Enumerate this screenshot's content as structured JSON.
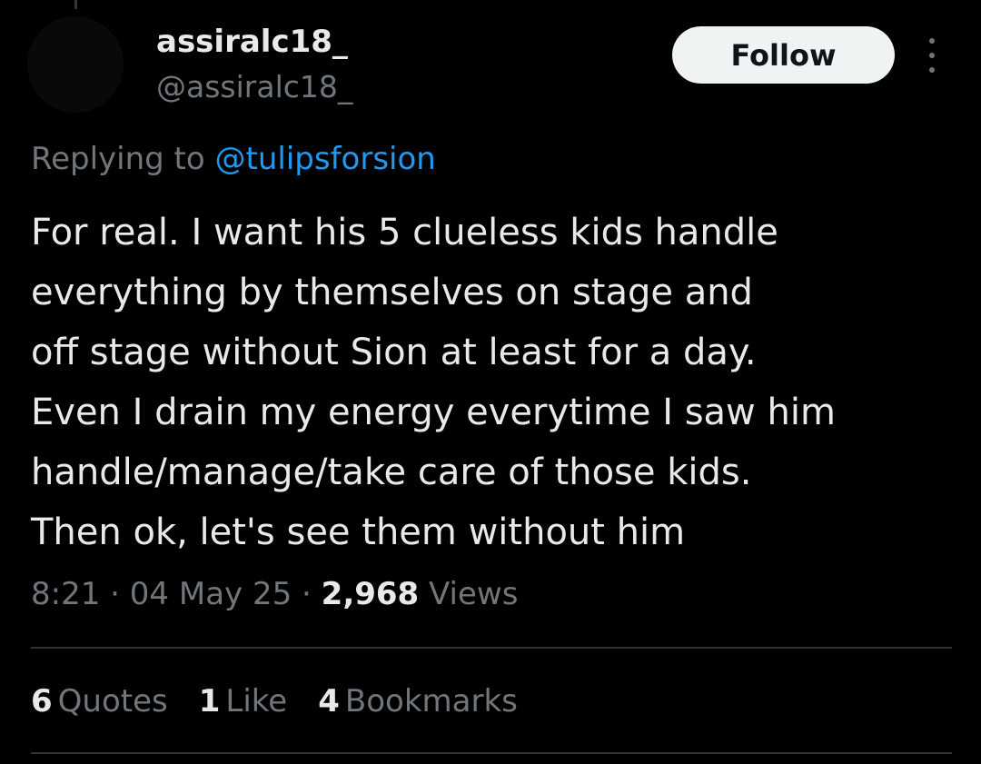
{
  "author": {
    "display_name": "assiralc18_",
    "handle": "@assiralc18_"
  },
  "follow_button": {
    "label": "Follow"
  },
  "reply_context": {
    "prefix": "Replying to ",
    "mention": "@tulipsforsion"
  },
  "tweet": {
    "lines": [
      "For real. I want his 5 clueless kids handle",
      "everything by themselves on stage and",
      "off stage without Sion at least for a day.",
      "Even I drain my energy everytime I saw him",
      "handle/manage/take care of those kids.",
      "Then ok, let's see them without him"
    ]
  },
  "meta": {
    "time": "8:21",
    "separator": " · ",
    "date": "04 May 25",
    "views_count": "2,968",
    "views_label": " Views"
  },
  "stats": {
    "quotes_count": "6",
    "quotes_label": "Quotes",
    "likes_count": "1",
    "likes_label": "Like",
    "bookmarks_count": "4",
    "bookmarks_label": "Bookmarks"
  },
  "icons": {
    "more": "more-vertical-icon"
  },
  "colors": {
    "background": "#000000",
    "text_primary": "#e7e9ea",
    "text_secondary": "#71767b",
    "link": "#1d9bf0",
    "follow_bg": "#eff3f4",
    "divider": "#2f3336"
  }
}
